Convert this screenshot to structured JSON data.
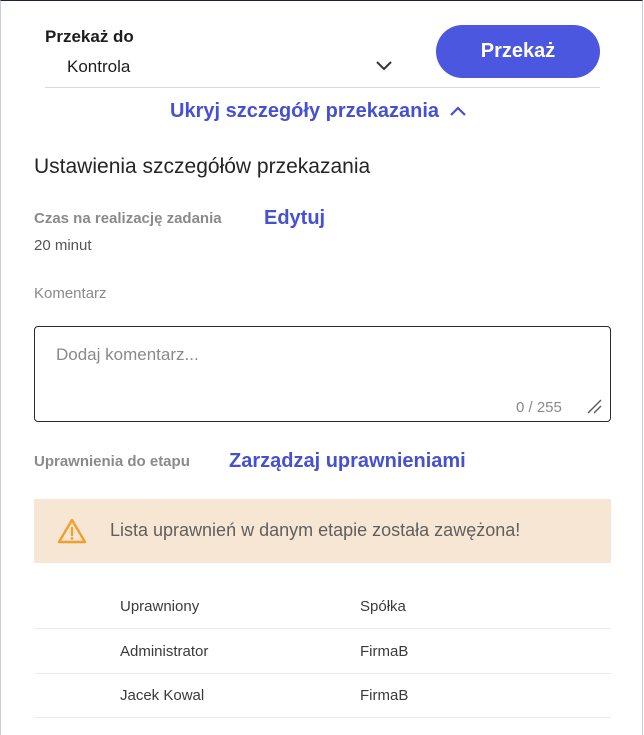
{
  "handover": {
    "label": "Przekaż do",
    "selected": "Kontrola",
    "submit_label": "Przekaż"
  },
  "details_toggle": {
    "label": "Ukryj szczegóły przekazania"
  },
  "settings": {
    "title": "Ustawienia szczegółów przekazania",
    "time_label": "Czas na realizację zadania",
    "time_value": "20 minut",
    "edit_label": "Edytuj",
    "comment_label": "Komentarz",
    "comment_placeholder": "Dodaj komentarz...",
    "comment_value": "",
    "comment_counter": "0 / 255",
    "permissions_label": "Uprawnienia do etapu",
    "manage_permissions_label": "Zarządzaj uprawnieniami"
  },
  "warning": {
    "text": "Lista uprawnień w danym etapie została zawężona!",
    "color": "#f8e6d4",
    "icon_color": "#f0a02a"
  },
  "permissions_table": {
    "headers": [
      "Uprawniony",
      "Spółka"
    ],
    "rows": [
      [
        "Administrator",
        "FirmaB"
      ],
      [
        "Jacek Kowal",
        "FirmaB"
      ]
    ]
  },
  "colors": {
    "accent": "#4b57de",
    "link": "#4650d2"
  }
}
